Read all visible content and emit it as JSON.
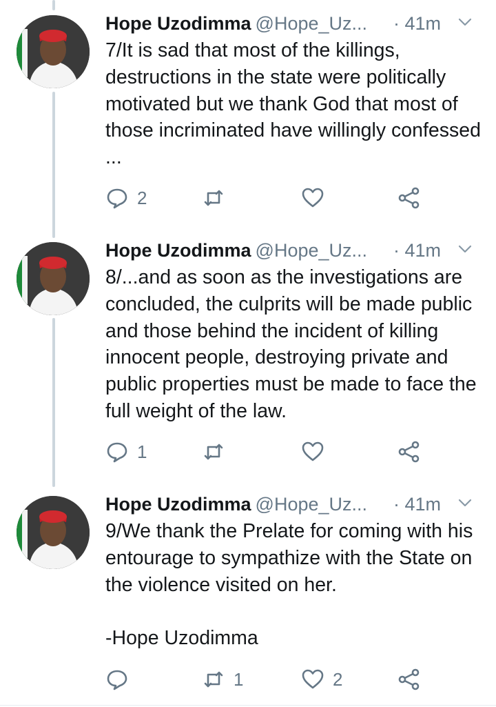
{
  "colors": {
    "text": "#14171a",
    "secondary": "#657786",
    "thread_line": "#ccd6dd"
  },
  "tweets": [
    {
      "name": "Hope Uzodimma",
      "handle": "@Hope_Uz...",
      "time": "· 41m",
      "text": "7/It is sad that most of the killings, destructions in the state were politically motivated but we thank God that most of those incriminated have willingly confessed ...",
      "replies": "2",
      "retweets": "",
      "likes": "",
      "icons": [
        "reply-icon",
        "retweet-icon",
        "like-icon",
        "share-icon",
        "chevron-down-icon"
      ]
    },
    {
      "name": "Hope Uzodimma",
      "handle": "@Hope_Uz...",
      "time": "· 41m",
      "text": "8/...and as soon as the investigations are concluded, the culprits will be made public and those behind the incident of killing innocent people, destroying private and public properties must be made to face the full weight of the law.",
      "replies": "1",
      "retweets": "",
      "likes": "",
      "icons": [
        "reply-icon",
        "retweet-icon",
        "like-icon",
        "share-icon",
        "chevron-down-icon"
      ]
    },
    {
      "name": "Hope Uzodimma",
      "handle": "@Hope_Uz...",
      "time": "· 41m",
      "text": "9/We thank the Prelate for coming with his entourage to sympathize with the State on the violence visited on her.\n\n-Hope Uzodimma",
      "replies": "",
      "retweets": "1",
      "likes": "2",
      "icons": [
        "reply-icon",
        "retweet-icon",
        "like-icon",
        "share-icon",
        "chevron-down-icon"
      ]
    }
  ]
}
